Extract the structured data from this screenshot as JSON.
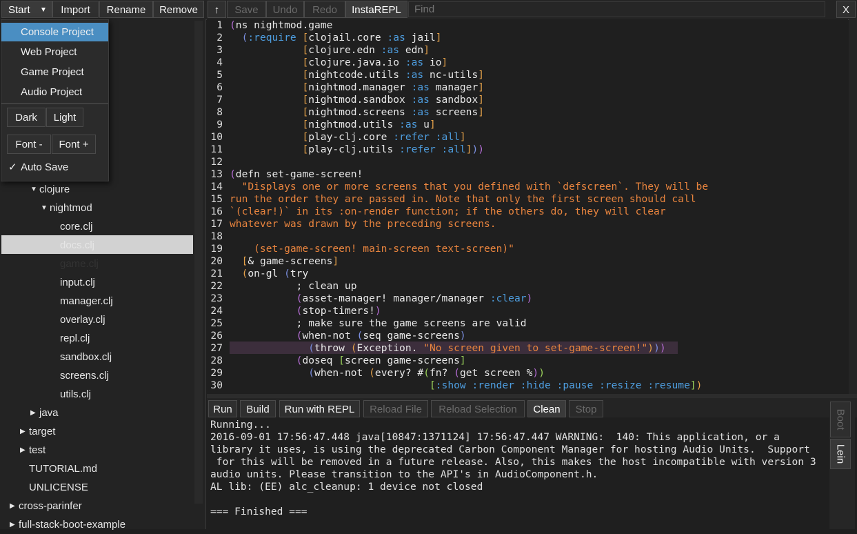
{
  "toolbar": {
    "start": "Start",
    "import": "Import",
    "rename": "Rename",
    "remove": "Remove",
    "up": "↑",
    "save": "Save",
    "undo": "Undo",
    "redo": "Redo",
    "instarepl": "InstaREPL",
    "find_placeholder": "Find",
    "close": "X"
  },
  "start_menu": {
    "items": [
      "Console Project",
      "Web Project",
      "Game Project",
      "Audio Project"
    ],
    "dark": "Dark",
    "light": "Light",
    "font_minus": "Font -",
    "font_plus": "Font +",
    "check": "✓",
    "auto_save": "Auto Save"
  },
  "tree": {
    "clojure": "clojure",
    "nightmod": "nightmod",
    "files": [
      "core.clj",
      "docs.clj",
      "game.clj",
      "input.clj",
      "manager.clj",
      "overlay.clj",
      "repl.clj",
      "sandbox.clj",
      "screens.clj",
      "utils.clj"
    ],
    "java": "java",
    "target": "target",
    "test": "test",
    "tutorial": "TUTORIAL.md",
    "unlicense": "UNLICENSE",
    "cross_parinfer": "cross-parinfer",
    "full_stack": "full-stack-boot-example"
  },
  "editor": {
    "line_numbers": [
      "1",
      "2",
      "3",
      "4",
      "5",
      "6",
      "7",
      "8",
      "9",
      "10",
      "11",
      "12",
      "13",
      "14",
      "15",
      "16",
      "17",
      "18",
      "19",
      "20",
      "21",
      "22",
      "23",
      "24",
      "25",
      "26",
      "27",
      "28",
      "29",
      "30"
    ]
  },
  "console_bar": {
    "run": "Run",
    "build": "Build",
    "run_with_repl": "Run with REPL",
    "reload_file": "Reload File",
    "reload_selection": "Reload Selection",
    "clean": "Clean",
    "stop": "Stop",
    "boot": "Boot",
    "lein": "Lein"
  },
  "console_output": [
    "Running...",
    "2016-09-01 17:56:47.448 java[10847:1371124] 17:56:47.447 WARNING:  140: This application, or a",
    "library it uses, is using the deprecated Carbon Component Manager for hosting Audio Units.  Support",
    " for this will be removed in a future release. Also, this makes the host incompatible with version 3",
    "audio units. Please transition to the API's in AudioComponent.h.",
    "AL lib: (EE) alc_cleanup: 1 device not closed",
    "",
    "=== Finished ==="
  ]
}
